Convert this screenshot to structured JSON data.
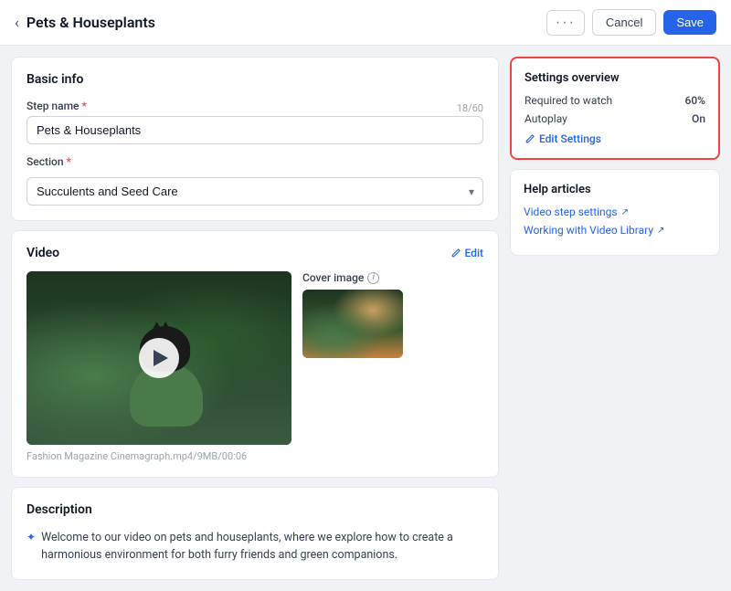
{
  "header": {
    "title": "Pets & Houseplants",
    "back_icon": "‹",
    "dots_icon": "···",
    "cancel_label": "Cancel",
    "save_label": "Save"
  },
  "basic_info": {
    "section_title": "Basic info",
    "step_name_label": "Step name",
    "step_name_required": true,
    "step_name_value": "Pets & Houseplants",
    "step_name_char_count": "18/60",
    "section_label": "Section",
    "section_required": true,
    "section_value": "Succulents and Seed Care"
  },
  "video": {
    "section_title": "Video",
    "edit_label": "Edit",
    "video_caption": "Fashion Magazine Cinemagraph.mp4/9MB/00:06",
    "cover_image_label": "Cover image"
  },
  "description": {
    "section_title": "Description",
    "text": "Welcome to our video on pets and houseplants, where we explore how to create a harmonious environment for both furry friends and green companions."
  },
  "settings_overview": {
    "title": "Settings overview",
    "required_to_watch_label": "Required to watch",
    "required_to_watch_value": "60%",
    "autoplay_label": "Autoplay",
    "autoplay_value": "On",
    "edit_settings_label": "Edit Settings"
  },
  "help_articles": {
    "title": "Help articles",
    "links": [
      {
        "label": "Video step settings"
      },
      {
        "label": "Working with Video Library"
      }
    ]
  }
}
